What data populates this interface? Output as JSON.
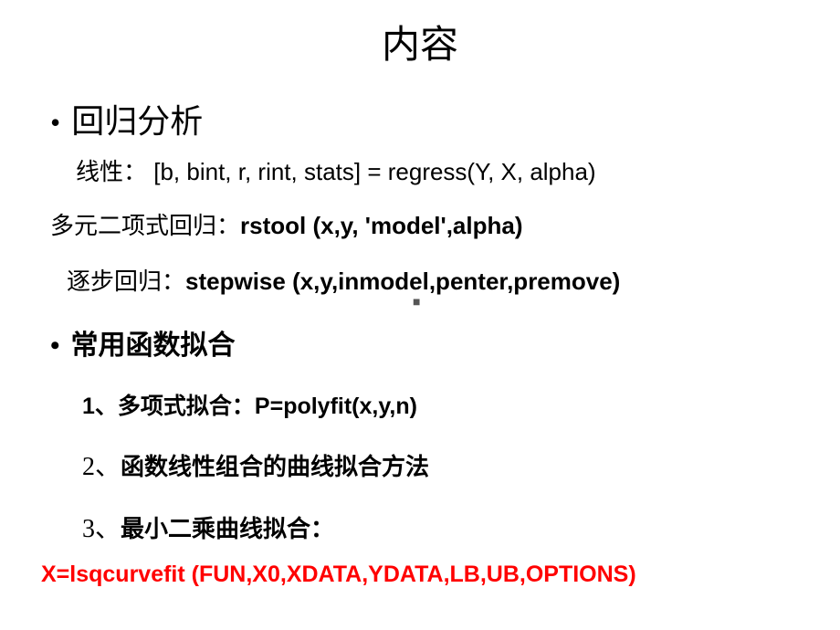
{
  "title": "内容",
  "bullet1": {
    "heading": "回归分析",
    "linear": {
      "label": "线性：",
      "formula": "  [b, bint, r, rint, stats] = regress(Y, X, alpha)"
    },
    "poly": {
      "label": "多元二项式回归：",
      "formula": "rstool (x,y, 'model',alpha)"
    },
    "step": {
      "label": "逐步回归：",
      "formula": "stepwise (x,y,inmodel,penter,premove)"
    }
  },
  "bullet2": {
    "heading": "常用函数拟合",
    "item1": {
      "num": "1、",
      "label": "多项式拟合：",
      "formula": "P=polyfit(x,y,n)"
    },
    "item2": {
      "num": "2、",
      "label": "函数线性组合的曲线拟合方法"
    },
    "item3": {
      "num": "3、",
      "label": "最小二乘曲线拟合",
      "suffix": "："
    }
  },
  "footer": "X=lsqcurvefit (FUN,X0,XDATA,YDATA,LB,UB,OPTIONS)",
  "center_mark": "■"
}
